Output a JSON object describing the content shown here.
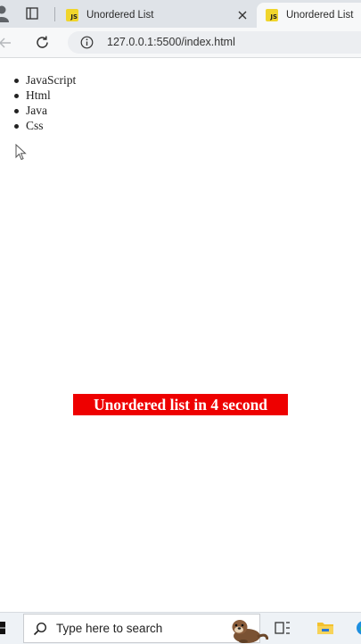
{
  "browser": {
    "tabs": [
      {
        "icon": "JS",
        "title": "Unordered List",
        "active": false
      },
      {
        "icon": "JS",
        "title": "Unordered List",
        "active": true
      }
    ],
    "url": "127.0.0.1:5500/index.html"
  },
  "page": {
    "list_items": [
      "JavaScript",
      "Html",
      "Java",
      "Css"
    ],
    "caption": "Unordered list in 4 second"
  },
  "taskbar": {
    "search_placeholder": "Type here to search"
  },
  "colors": {
    "caption_bg": "#ee0000",
    "caption_text": "#ffffff",
    "js_icon": "#f0d52c",
    "tabstrip_bg": "#dfe3e8",
    "toolbar_bg": "#f7f8f9"
  }
}
